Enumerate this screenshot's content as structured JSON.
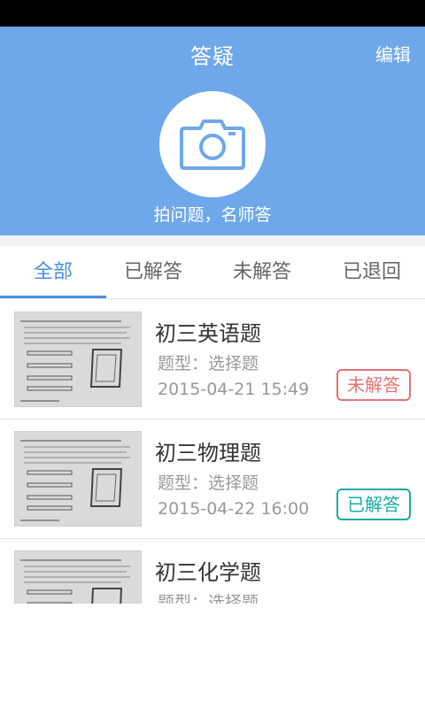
{
  "header": {
    "title": "答疑",
    "edit_label": "编辑",
    "subtitle": "拍问题，名师答",
    "accent_color": "#6ea8ea",
    "camera_icon": "camera-icon"
  },
  "tabs": [
    {
      "label": "全部",
      "active": true
    },
    {
      "label": "已解答",
      "active": false
    },
    {
      "label": "未解答",
      "active": false
    },
    {
      "label": "已退回",
      "active": false
    }
  ],
  "questions": [
    {
      "title": "初三英语题",
      "type": "题型：选择题",
      "date": "2015-04-21  15:49",
      "status": "未解答",
      "status_color": "#e57373"
    },
    {
      "title": "初三物理题",
      "type": "题型：选择题",
      "date": "2015-04-22 16:00",
      "status": "已解答",
      "status_color": "#1aaba2"
    },
    {
      "title": "初三化学题",
      "type": "题型：选择题",
      "date": "",
      "status": "",
      "status_color": ""
    }
  ]
}
